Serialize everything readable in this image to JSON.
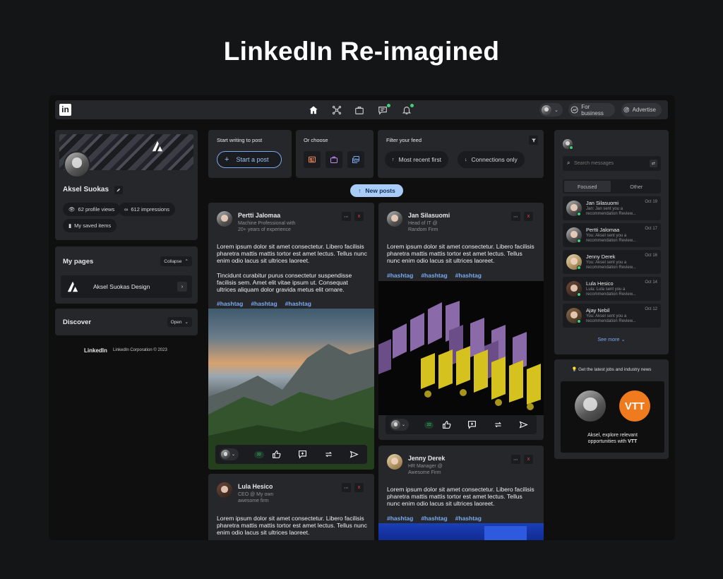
{
  "hero": {
    "title": "LinkedIn Re-imagined"
  },
  "header": {
    "logo_text": "in",
    "for_business": "For business",
    "advertise": "Advertise"
  },
  "profile": {
    "name": "Aksel Suokas",
    "views": "62 profile views",
    "impressions": "612 impressions",
    "saved": "My saved items"
  },
  "pages": {
    "title": "My pages",
    "collapse": "Collapse",
    "page_name": "Aksel Suokas Design"
  },
  "discover": {
    "title": "Discover",
    "open": "Open"
  },
  "footer": {
    "brand": "LinkedIn",
    "copyright": "LinkedIn Corporation © 2023"
  },
  "composer": {
    "label": "Start writing to post",
    "start_post": "Start a post",
    "or_choose": "Or choose",
    "filter_label": "Filter your feed",
    "most_recent": "Most recent first",
    "connections": "Connections only"
  },
  "new_posts": "New posts",
  "posts": [
    {
      "name": "Pertti Jalomaa",
      "headline1": "Machine Professional with",
      "headline2": "20+ years of experience",
      "p1": "Lorem ipsum dolor sit amet consectetur. Libero facilisis pharetra mattis mattis tortor est amet lectus. Tellus nunc enim odio lacus sit ultrices laoreet.",
      "p2": "Tincidunt curabitur purus consectetur suspendisse facilisis sem. Amet elit vitae ipsum ut. Consequat ultrices aliquam dolor gravida metus elit ornare.",
      "tags": [
        "#hashtag",
        "#hashtag",
        "#hashtag"
      ],
      "count": "32"
    },
    {
      "name": "Jan Silasuomi",
      "headline1": "Head of IT @",
      "headline2": "Random Firm",
      "p1": "Lorem ipsum dolor sit amet consectetur. Libero facilisis pharetra mattis mattis tortor est amet lectus. Tellus nunc enim odio lacus sit ultrices laoreet.",
      "tags": [
        "#hashtag",
        "#hashtag",
        "#hashtag"
      ],
      "count": "32"
    },
    {
      "name": "Lula Hesico",
      "headline1": "CEO @ My own",
      "headline2": "awesome firm",
      "p1": "Lorem ipsum dolor sit amet consectetur. Libero facilisis pharetra mattis mattis tortor est amet lectus. Tellus nunc enim odio lacus sit ultrices laoreet."
    },
    {
      "name": "Jenny Derek",
      "headline1": "HR Manager @",
      "headline2": "Awesome Firm",
      "p1": "Lorem ipsum dolor sit amet consectetur. Libero facilisis pharetra mattis mattis tortor est amet lectus. Tellus nunc enim odio lacus sit ultrices laoreet.",
      "tags": [
        "#hashtag",
        "#hashtag",
        "#hashtag"
      ]
    }
  ],
  "messages": {
    "search_placeholder": "Search messages",
    "tab_focused": "Focused",
    "tab_other": "Other",
    "items": [
      {
        "name": "Jan Silasuomi",
        "preview": "Jan: Jan sent you a recommendation Review...",
        "date": "Oct 19"
      },
      {
        "name": "Pertti Jalomaa",
        "preview": "You: Aksel sent you a recommendation Review...",
        "date": "Oct 17"
      },
      {
        "name": "Jenny Derek",
        "preview": "You: Aksel sent you a recommendation Review...",
        "date": "Oct 16"
      },
      {
        "name": "Lula Hesico",
        "preview": "Lula: Lula sent you a recommendation Review...",
        "date": "Oct 14"
      },
      {
        "name": "Ajay Nebil",
        "preview": "You: Aksel sent you a recommendation Review...",
        "date": "Oct 12"
      }
    ],
    "see_more": "See more"
  },
  "ad": {
    "label": "Get the latest jobs and industry news",
    "logo": "VTT",
    "text1": "Aksel, explore relevant",
    "text2_prefix": "opportunities with ",
    "text2_brand": "VTT"
  },
  "colors": {
    "accent_blue": "#78a9f0",
    "online_green": "#3fd07a",
    "vtt_orange": "#f07a1e",
    "danger_red": "#e04848"
  }
}
